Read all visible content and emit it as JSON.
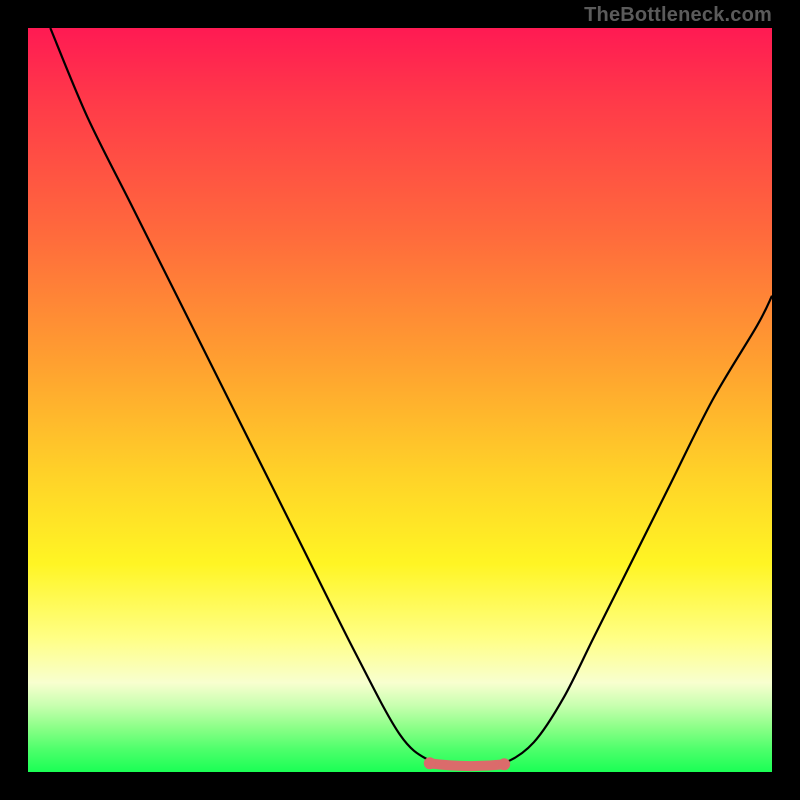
{
  "watermark": "TheBottleneck.com",
  "chart_data": {
    "type": "line",
    "title": "",
    "xlabel": "",
    "ylabel": "",
    "xlim": [
      0,
      100
    ],
    "ylim": [
      0,
      100
    ],
    "grid": false,
    "series": [
      {
        "name": "bottleneck-curve",
        "x": [
          3,
          8,
          14,
          20,
          28,
          36,
          44,
          50,
          54,
          57,
          60,
          64,
          68,
          72,
          76,
          80,
          86,
          92,
          98,
          100
        ],
        "y": [
          100,
          88,
          76,
          64,
          48,
          32,
          16,
          5,
          1.5,
          0.8,
          0.8,
          1.2,
          4,
          10,
          18,
          26,
          38,
          50,
          60,
          64
        ]
      }
    ],
    "annotations": [
      {
        "name": "minimum-marker",
        "type": "thick-segment",
        "color": "#e06666",
        "x_range": [
          54,
          64
        ],
        "y": 0.9
      }
    ],
    "background": {
      "type": "vertical-gradient",
      "stops": [
        {
          "pos": 0.0,
          "color": "#ff1a53"
        },
        {
          "pos": 0.1,
          "color": "#ff3a49"
        },
        {
          "pos": 0.28,
          "color": "#ff6b3c"
        },
        {
          "pos": 0.45,
          "color": "#ffa030"
        },
        {
          "pos": 0.6,
          "color": "#ffd228"
        },
        {
          "pos": 0.72,
          "color": "#fff524"
        },
        {
          "pos": 0.82,
          "color": "#ffff85"
        },
        {
          "pos": 0.88,
          "color": "#f8ffcf"
        },
        {
          "pos": 0.91,
          "color": "#c9ffb0"
        },
        {
          "pos": 0.94,
          "color": "#8cff88"
        },
        {
          "pos": 0.97,
          "color": "#4dff6b"
        },
        {
          "pos": 1.0,
          "color": "#1aff55"
        }
      ]
    }
  }
}
